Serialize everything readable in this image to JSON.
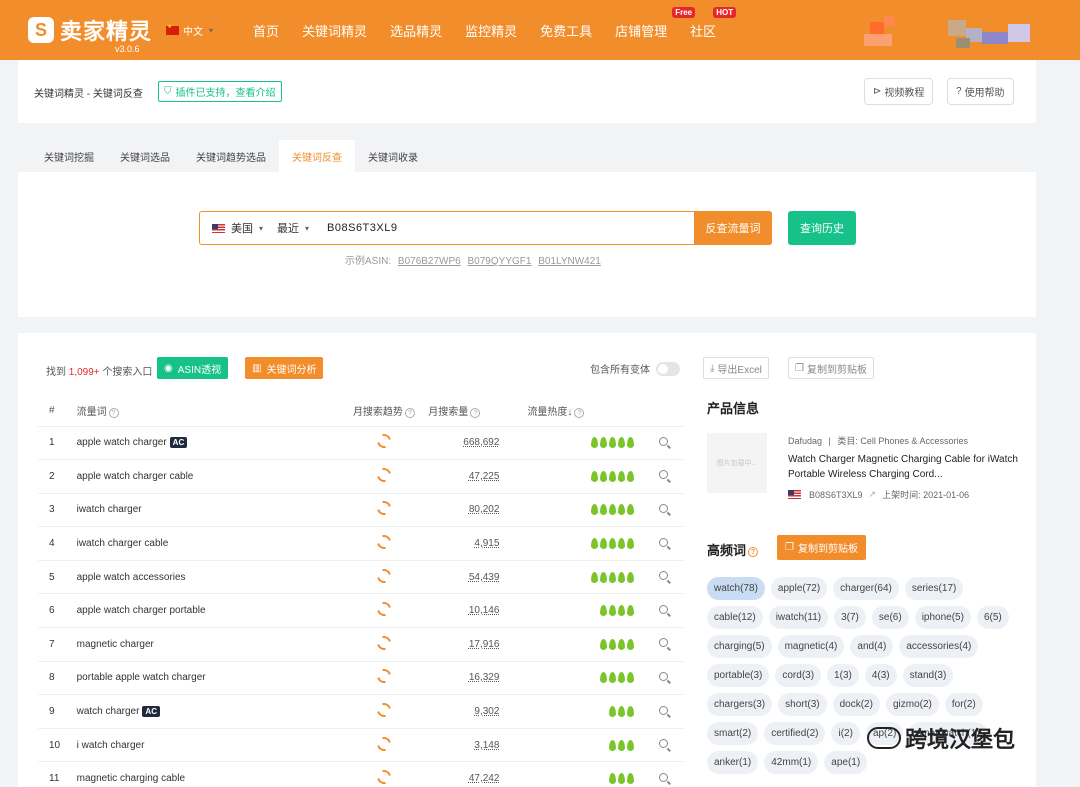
{
  "header": {
    "logo_text": "卖家精灵",
    "version": "v3.0.6",
    "lang": "中文",
    "nav": [
      {
        "label": "首页"
      },
      {
        "label": "关键词精灵"
      },
      {
        "label": "选品精灵"
      },
      {
        "label": "监控精灵"
      },
      {
        "label": "免费工具"
      },
      {
        "label": "店铺管理",
        "badge": "Free"
      },
      {
        "label": "社区",
        "badge": "HOT"
      }
    ]
  },
  "topbar": {
    "breadcrumb": "关键词精灵 - 关键词反查",
    "plugin": "插件已支持，查看介绍",
    "video": "视频教程",
    "help": "使用帮助"
  },
  "tabs": [
    "关键词挖掘",
    "关键词选品",
    "关键词趋势选品",
    "关键词反查",
    "关键词收录"
  ],
  "search": {
    "country": "美国",
    "period": "最近",
    "asin": "B08S6T3XL9",
    "button": "反查流量词",
    "history": "查询历史",
    "examples_label": "示例ASIN:",
    "examples": [
      "B076B27WP6",
      "B079QYYGF1",
      "B01LYNW421"
    ]
  },
  "results": {
    "found_prefix": "找到",
    "found_count": "1,099+",
    "found_suffix": "个搜索入口",
    "asin_btn": "ASIN透视",
    "analysis_btn": "关键词分析",
    "variant_label": "包含所有变体",
    "export": "导出Excel",
    "copy": "复制到剪贴板",
    "columns": {
      "num": "#",
      "keyword": "流量词",
      "trend": "月搜索趋势",
      "volume": "月搜索量",
      "heat": "流量热度↓"
    },
    "rows": [
      {
        "num": "1",
        "keyword": "apple watch charger",
        "ac": "AC",
        "volume": "668,692",
        "leaves": 5
      },
      {
        "num": "2",
        "keyword": "apple watch charger cable",
        "ac": "",
        "volume": "47,225",
        "leaves": 5
      },
      {
        "num": "3",
        "keyword": "iwatch charger",
        "ac": "",
        "volume": "80,202",
        "leaves": 5
      },
      {
        "num": "4",
        "keyword": "iwatch charger cable",
        "ac": "",
        "volume": "4,915",
        "leaves": 5
      },
      {
        "num": "5",
        "keyword": "apple watch accessories",
        "ac": "",
        "volume": "54,439",
        "leaves": 5
      },
      {
        "num": "6",
        "keyword": "apple watch charger portable",
        "ac": "",
        "volume": "10,146",
        "leaves": 4
      },
      {
        "num": "7",
        "keyword": "magnetic charger",
        "ac": "",
        "volume": "17,916",
        "leaves": 4
      },
      {
        "num": "8",
        "keyword": "portable apple watch charger",
        "ac": "",
        "volume": "16,329",
        "leaves": 4
      },
      {
        "num": "9",
        "keyword": "watch charger",
        "ac": "AC",
        "volume": "9,302",
        "leaves": 3
      },
      {
        "num": "10",
        "keyword": "i watch charger",
        "ac": "",
        "volume": "3,148",
        "leaves": 3
      },
      {
        "num": "11",
        "keyword": "magnetic charging cable",
        "ac": "",
        "volume": "47,242",
        "leaves": 3
      }
    ]
  },
  "product": {
    "title": "产品信息",
    "img_placeholder": "图片加载中...",
    "brand": "Dafudag",
    "category": "类目: Cell Phones & Accessories",
    "name": "Watch Charger Magnetic Charging Cable for iWatch Portable Wireless Charging Cord...",
    "asin": "B08S6T3XL9",
    "launch": "上架时间: 2021-01-06"
  },
  "high_freq": {
    "title": "高频词",
    "copy": "复制到剪贴板",
    "chips": [
      {
        "label": "watch(78)",
        "on": true
      },
      {
        "label": "apple(72)"
      },
      {
        "label": "charger(64)"
      },
      {
        "label": "series(17)"
      },
      {
        "label": "cable(12)"
      },
      {
        "label": "iwatch(11)"
      },
      {
        "label": "3(7)"
      },
      {
        "label": "se(6)"
      },
      {
        "label": "iphone(5)"
      },
      {
        "label": "6(5)"
      },
      {
        "label": "charging(5)"
      },
      {
        "label": "magnetic(4)"
      },
      {
        "label": "and(4)"
      },
      {
        "label": "accessories(4)"
      },
      {
        "label": "portable(3)"
      },
      {
        "label": "cord(3)"
      },
      {
        "label": "1(3)"
      },
      {
        "label": "4(3)"
      },
      {
        "label": "stand(3)"
      },
      {
        "label": "chargers(3)"
      },
      {
        "label": "short(3)"
      },
      {
        "label": "dock(2)"
      },
      {
        "label": "gizmo(2)"
      },
      {
        "label": "for(2)"
      },
      {
        "label": "smart(2)"
      },
      {
        "label": "certified(2)"
      },
      {
        "label": "i(2)"
      },
      {
        "label": "ap(2)"
      },
      {
        "label": "smartwatch(1)"
      },
      {
        "label": "anker(1)"
      },
      {
        "label": "42mm(1)"
      },
      {
        "label": "ape(1)"
      }
    ]
  },
  "watermark": "跨境汉堡包",
  "colors": {
    "brand": "#f28d2b",
    "green": "#17c28a",
    "leaf": "#7bc52a"
  }
}
